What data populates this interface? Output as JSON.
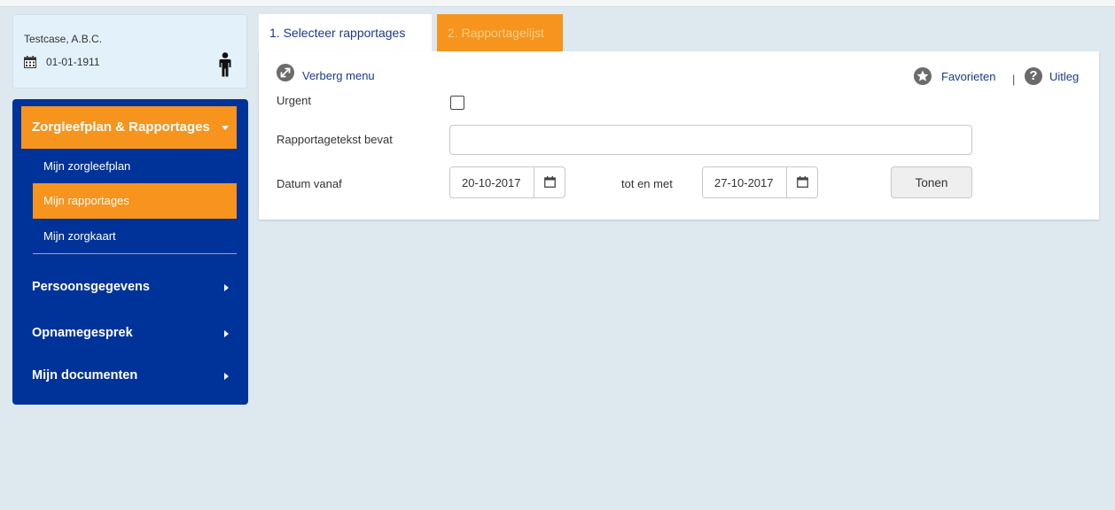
{
  "patient": {
    "name": "Testcase, A.B.C.",
    "birth_date": "01-01-1911",
    "icons": [
      "calendar-icon",
      "person-icon"
    ]
  },
  "sidebar": {
    "section": {
      "label": "Zorgleefplan & Rapportages",
      "items": [
        {
          "label": "Mijn zorgleefplan",
          "active": false
        },
        {
          "label": "Mijn rapportages",
          "active": true
        },
        {
          "label": "Mijn zorgkaart",
          "active": false
        }
      ]
    },
    "nav": [
      {
        "label": "Persoonsgegevens"
      },
      {
        "label": "Opnamegesprek"
      },
      {
        "label": "Mijn documenten"
      }
    ]
  },
  "tabs": [
    {
      "label": "1. Selecteer rapportages",
      "active": true
    },
    {
      "label": "2. Rapportagelijst",
      "active": false
    }
  ],
  "toolbar": {
    "hide_menu": "Verberg menu",
    "favorites": "Favorieten",
    "separator": "|",
    "help": "Uitleg",
    "help_glyph": "?"
  },
  "form": {
    "urgent_label": "Urgent",
    "urgent_checked": false,
    "text_label": "Rapportagetekst bevat",
    "text_value": "",
    "date_from_label": "Datum vanaf",
    "date_from": "20-10-2017",
    "until_label": "tot en met",
    "date_to": "27-10-2017",
    "show_button": "Tonen"
  },
  "colors": {
    "sidebar_bg": "#003399",
    "accent": "#f7941d",
    "link": "#1a3a8f",
    "page_bg": "#dde9ee",
    "patient_card_bg": "#e3f1fb"
  }
}
